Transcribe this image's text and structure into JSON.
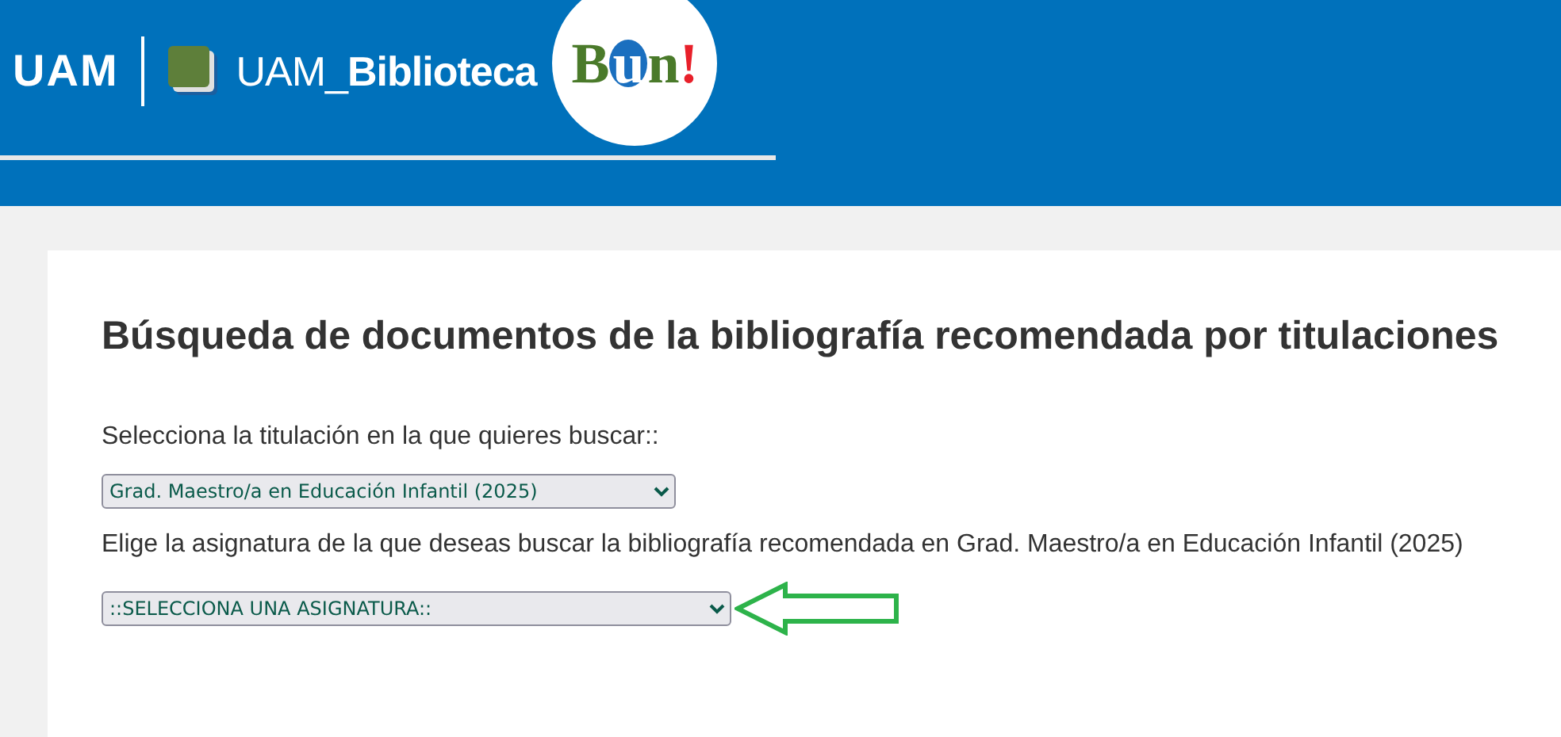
{
  "header": {
    "uam_logo": "UAM",
    "library_logo": "UAM_**Biblioteca**",
    "bun_logo": [
      {
        "text": "B",
        "color": "#4a7a2a"
      },
      {
        "text": "u",
        "color": "#1a6fbf"
      },
      {
        "text": "n",
        "color": "#4a7a2a"
      },
      {
        "text": "!",
        "color": "#e8202a"
      }
    ]
  },
  "page": {
    "title": "Búsqueda de documentos de la bibliografía recomendada por titulaciones",
    "degree_label": "Selecciona la titulación en la que quieres buscar::",
    "degree_select": "Grad. Maestro/a en Educación Infantil (2025)",
    "subject_label": "Elige la asignatura de la que deseas buscar la bibliografía recomendada en Grad. Maestro/a en Educación Infantil (2025)",
    "subject_select": "::SELECCIONA UNA ASIGNATURA::"
  }
}
